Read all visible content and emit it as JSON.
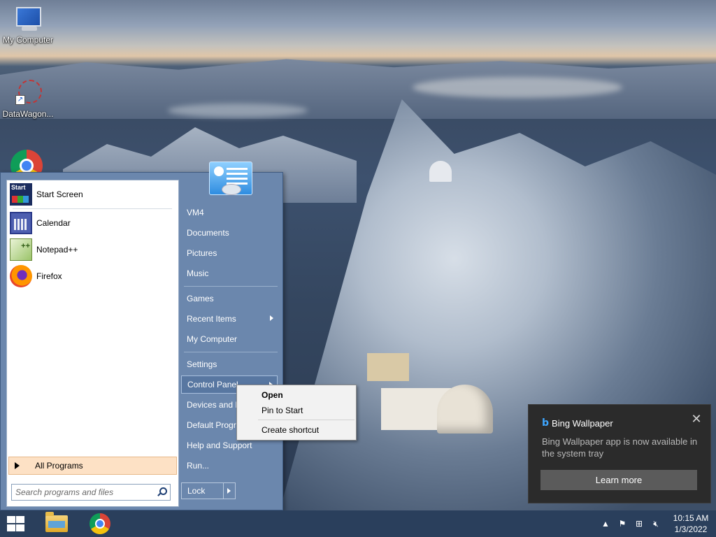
{
  "desktop": {
    "icons": [
      {
        "label": "My Computer"
      },
      {
        "label": "DataWagon..."
      },
      {
        "label": ""
      }
    ]
  },
  "start_menu": {
    "pinned": [
      {
        "label": "Start Screen",
        "icon": "start-screen-icon"
      },
      {
        "label": "Calendar",
        "icon": "calendar-icon"
      },
      {
        "label": "Notepad++",
        "icon": "notepad-plus-plus-icon"
      },
      {
        "label": "Firefox",
        "icon": "firefox-icon"
      }
    ],
    "all_programs": "All Programs",
    "search_placeholder": "Search programs and files",
    "right_links": [
      {
        "label": "VM4"
      },
      {
        "label": "Documents"
      },
      {
        "label": "Pictures"
      },
      {
        "label": "Music"
      },
      {
        "label": "Games"
      },
      {
        "label": "Recent Items",
        "submenu": true
      },
      {
        "label": "My Computer"
      },
      {
        "label": "Settings"
      },
      {
        "label": "Control Panel",
        "submenu": true
      },
      {
        "label": "Devices and P"
      },
      {
        "label": "Default Progra"
      },
      {
        "label": "Help and Support"
      },
      {
        "label": "Run..."
      }
    ],
    "lock_label": "Lock"
  },
  "context_menu": {
    "items": [
      "Open",
      "Pin to Start",
      "Create shortcut"
    ]
  },
  "toast": {
    "app": "Bing Wallpaper",
    "message": "Bing Wallpaper app is now available in the system tray",
    "button": "Learn more",
    "logo": "b"
  },
  "taskbar": {
    "time": "10:15 AM",
    "date": "1/3/2022",
    "tray_icons": [
      "chevron-up-icon",
      "action-center-flag-icon",
      "network-icon",
      "volume-muted-icon"
    ]
  },
  "colors": {
    "start_menu_bg": "#6b87ad",
    "taskbar_bg": "#2a3f5c",
    "toast_bg": "#2b2b2b",
    "all_programs_bg": "#fde1c5"
  }
}
